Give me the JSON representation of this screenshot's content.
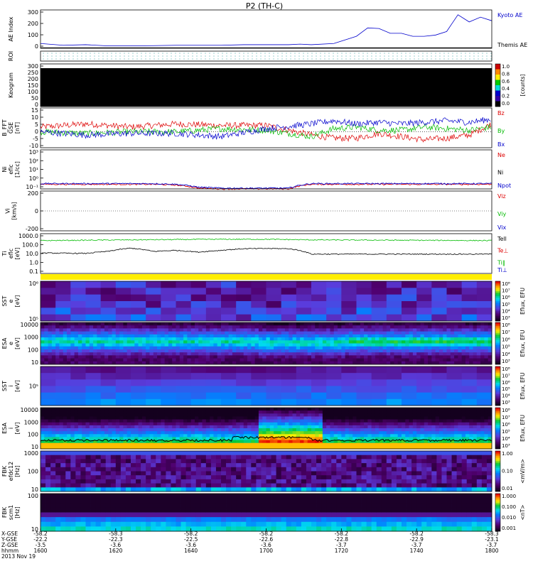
{
  "title": "P2 (TH-C)",
  "colors": {
    "blue": "#0000cc",
    "red": "#dd0000",
    "green": "#00bb00",
    "yellow": "#ffee00",
    "cyan": "#00e0e0",
    "black": "#000000"
  },
  "panels": [
    {
      "id": "ae",
      "ylabel": [
        "AE Index"
      ],
      "yticks": [
        "300",
        "200",
        "100",
        "0"
      ],
      "legend": [
        {
          "text": "Kyoto AE",
          "color": "#0000cc"
        },
        {
          "text": "Themis AE",
          "color": "#000000"
        }
      ]
    },
    {
      "id": "roi",
      "ylabel": [
        "ROI"
      ],
      "yticks": [],
      "legend": []
    },
    {
      "id": "keogram",
      "ylabel": [
        "Keogram"
      ],
      "yticks": [
        "300",
        "250",
        "200",
        "150",
        "100",
        "50",
        "0"
      ],
      "colorbar": {
        "ticks": [
          "1.0",
          "0.8",
          "0.6",
          "0.4",
          "0.2",
          "0.0"
        ],
        "label": "[counts]"
      },
      "legend": []
    },
    {
      "id": "bfield",
      "ylabel": [
        "B_FFT",
        "GSE",
        "[nT]"
      ],
      "yticks": [
        "15",
        "10",
        "5",
        "0",
        "-5",
        "-10"
      ],
      "legend": [
        {
          "text": "Bz",
          "color": "#dd0000"
        },
        {
          "text": "By",
          "color": "#00bb00"
        },
        {
          "text": "Bx",
          "color": "#0000cc"
        }
      ]
    },
    {
      "id": "density",
      "ylabel": [
        "Ni",
        "eflc",
        "[1/cc]"
      ],
      "yticks": [
        "10³",
        "10²",
        "10¹",
        "10⁰",
        "10⁻¹"
      ],
      "legend": [
        {
          "text": "Ne",
          "color": "#dd0000"
        },
        {
          "text": "Ni",
          "color": "#000000"
        },
        {
          "text": "Npot",
          "color": "#0000cc"
        }
      ]
    },
    {
      "id": "velocity",
      "ylabel": [
        "Vi",
        "[km/s]"
      ],
      "yticks": [
        "200",
        "0",
        "-200"
      ],
      "legend": [
        {
          "text": "Viz",
          "color": "#dd0000"
        },
        {
          "text": "Viy",
          "color": "#00bb00"
        },
        {
          "text": "Vix",
          "color": "#0000cc"
        }
      ]
    },
    {
      "id": "temperature",
      "ylabel": [
        "Ti",
        "eflc",
        "[eV]"
      ],
      "yticks": [
        "1000.0",
        "100.0",
        "10.0",
        "1.0",
        "0.1"
      ],
      "legend": [
        {
          "text": "Tell",
          "color": "#000000"
        },
        {
          "text": "Te⊥",
          "color": "#dd0000"
        },
        {
          "text": "Ti‖",
          "color": "#00bb00"
        },
        {
          "text": "Ti⊥",
          "color": "#0000cc"
        }
      ]
    },
    {
      "id": "sst_e",
      "ylabel": [
        "SST",
        "e",
        "[eV]"
      ],
      "yticks": [
        "10⁶",
        "10⁵"
      ],
      "colorbar": {
        "ticks": [
          "10⁸",
          "10⁷",
          "10⁶",
          "10⁵",
          "10⁴",
          "10³"
        ],
        "label": "Eflux, EFU"
      },
      "legend": []
    },
    {
      "id": "esa_e",
      "ylabel": [
        "ESA",
        "e",
        "[eV]"
      ],
      "yticks": [
        "10000",
        "1000",
        "100",
        "10"
      ],
      "colorbar": {
        "ticks": [
          "10⁸",
          "10⁷",
          "10⁶",
          "10⁵",
          "10⁴",
          "10³"
        ],
        "label": "Eflux, EFU"
      },
      "legend": []
    },
    {
      "id": "sst_i",
      "ylabel": [
        "SST",
        "i",
        "[eV]"
      ],
      "yticks": [
        "10⁵"
      ],
      "colorbar": {
        "ticks": [
          "10⁸",
          "10⁷",
          "10⁶",
          "10⁵",
          "10⁴",
          "10³"
        ],
        "label": "Eflux, EFU"
      },
      "legend": []
    },
    {
      "id": "esa_i",
      "ylabel": [
        "ESA",
        "i",
        "[eV]"
      ],
      "yticks": [
        "10000",
        "1000",
        "100",
        "10"
      ],
      "colorbar": {
        "ticks": [
          "10⁸",
          "10⁷",
          "10⁶",
          "10⁵",
          "10⁴",
          "10³"
        ],
        "label": "Eflux, EFU"
      },
      "legend": []
    },
    {
      "id": "fbk_e",
      "ylabel": [
        "FBK",
        "efdc12",
        "[Hz]"
      ],
      "yticks": [
        "1000",
        "100",
        "10"
      ],
      "colorbar": {
        "ticks": [
          "1.00",
          "0.10",
          "0.01"
        ],
        "label": "<mV/m>"
      },
      "legend": []
    },
    {
      "id": "fbk_b",
      "ylabel": [
        "FBK",
        "scm1",
        "[Hz]"
      ],
      "yticks": [
        "100",
        "10"
      ],
      "colorbar": {
        "ticks": [
          "1.000",
          "0.100",
          "0.010",
          "0.001"
        ],
        "label": "<nT>"
      },
      "legend": []
    }
  ],
  "xaxis": {
    "row_labels": [
      "X-GSE",
      "Y-GSE",
      "Z-GSE",
      "hhmm",
      "2013 Nov 19"
    ],
    "columns": [
      {
        "x": "-58.2",
        "y": "-22.2",
        "z": "-3.5",
        "t": "1600"
      },
      {
        "x": "-58.3",
        "y": "-22.3",
        "z": "-3.6",
        "t": "1620"
      },
      {
        "x": "-58.2",
        "y": "-22.5",
        "z": "-3.6",
        "t": "1640"
      },
      {
        "x": "-58.2",
        "y": "-22.6",
        "z": "-3.6",
        "t": "1700"
      },
      {
        "x": "-58.2",
        "y": "-22.8",
        "z": "-3.7",
        "t": "1720"
      },
      {
        "x": "-58.2",
        "y": "-22.9",
        "z": "-3.7",
        "t": "1740"
      },
      {
        "x": "-58.3",
        "y": "-23.1",
        "z": "-3.7",
        "t": "1800"
      }
    ]
  },
  "chart_data": [
    {
      "type": "line",
      "id": "ae",
      "x_range": [
        1600,
        1800
      ],
      "series": [
        {
          "name": "Kyoto AE",
          "x": [
            1600,
            1610,
            1620,
            1630,
            1640,
            1650,
            1660,
            1670,
            1680,
            1690,
            1700,
            1710,
            1715,
            1720,
            1730,
            1740,
            1745,
            1750,
            1755,
            1760,
            1765,
            1770,
            1775,
            1780,
            1785,
            1790,
            1795,
            1800
          ],
          "y": [
            40,
            25,
            30,
            20,
            20,
            22,
            25,
            25,
            25,
            30,
            30,
            30,
            35,
            30,
            40,
            100,
            170,
            165,
            125,
            125,
            100,
            100,
            110,
            140,
            280,
            220,
            260,
            230
          ]
        },
        {
          "name": "Themis AE",
          "x": [
            1600,
            1800
          ],
          "y": [
            5,
            5
          ]
        }
      ],
      "ylim": [
        0,
        320
      ]
    },
    {
      "type": "line",
      "id": "bfield",
      "x_range": [
        1600,
        1800
      ],
      "series": [
        {
          "name": "Bz",
          "x": [
            1600,
            1620,
            1640,
            1660,
            1680,
            1700,
            1720,
            1730,
            1740,
            1750,
            1760,
            1770,
            1780,
            1790,
            1800
          ],
          "y": [
            3,
            5,
            3,
            5,
            4,
            4,
            -2,
            -4,
            -4,
            -1,
            -3,
            -5,
            -4,
            -2,
            5
          ]
        },
        {
          "name": "By",
          "x": [
            1600,
            1620,
            1640,
            1660,
            1680,
            1700,
            1720,
            1730,
            1740,
            1750,
            1760,
            1770,
            1780,
            1790,
            1800
          ],
          "y": [
            0,
            -1,
            0,
            0,
            2,
            1,
            -3,
            2,
            3,
            1,
            1,
            3,
            2,
            1,
            3
          ]
        },
        {
          "name": "Bx",
          "x": [
            1600,
            1620,
            1640,
            1660,
            1680,
            1700,
            1720,
            1730,
            1740,
            1750,
            1760,
            1770,
            1780,
            1790,
            1800
          ],
          "y": [
            0,
            -2,
            -1,
            -1,
            -3,
            2,
            5,
            7,
            5,
            6,
            5,
            6,
            7,
            6,
            8
          ]
        }
      ],
      "ylim": [
        -10,
        15
      ]
    },
    {
      "type": "line",
      "id": "density",
      "x_range": [
        1600,
        1800
      ],
      "series": [
        {
          "name": "Ne",
          "x": [
            1600,
            1650,
            1660,
            1670,
            1680,
            1700,
            1710,
            1720,
            1800
          ],
          "y": [
            0.3,
            0.3,
            0.25,
            0.12,
            0.1,
            0.1,
            0.1,
            0.3,
            0.3
          ]
        },
        {
          "name": "Npot",
          "x": [
            1600,
            1650,
            1660,
            1670,
            1680,
            1700,
            1710,
            1720,
            1800
          ],
          "y": [
            0.35,
            0.35,
            0.3,
            0.15,
            0.12,
            0.12,
            0.12,
            0.35,
            0.35
          ]
        }
      ],
      "ylim": [
        0.1,
        1000
      ],
      "yscale": "log"
    },
    {
      "type": "line",
      "id": "temperature",
      "x_range": [
        1600,
        1800
      ],
      "series": [
        {
          "name": "Te⊥",
          "x": [
            1600,
            1640,
            1680,
            1700,
            1720,
            1800
          ],
          "y": [
            500,
            600,
            700,
            700,
            600,
            500
          ]
        },
        {
          "name": "Tell",
          "x": [
            1600,
            1620,
            1630,
            1640,
            1650,
            1660,
            1670,
            1680,
            1690,
            1700,
            1710,
            1720,
            1800
          ],
          "y": [
            20,
            18,
            30,
            70,
            30,
            40,
            25,
            40,
            60,
            65,
            60,
            15,
            15
          ]
        }
      ],
      "ylim": [
        0.1,
        3000
      ],
      "yscale": "log"
    }
  ]
}
